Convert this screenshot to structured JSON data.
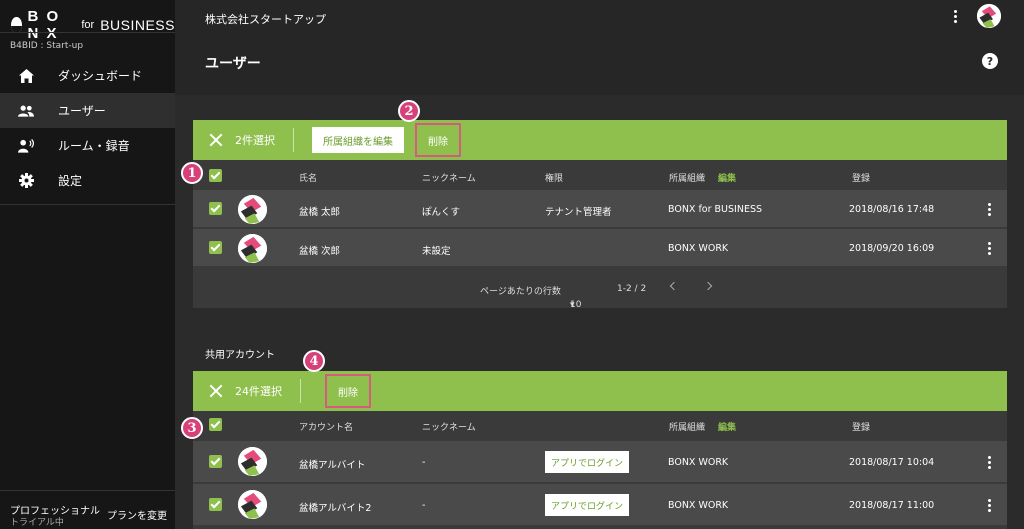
{
  "brand": {
    "name": "B O N X",
    "for": "for",
    "business": "BUSINESS"
  },
  "sidebar": {
    "org": "B4BID : Start-up",
    "items": [
      {
        "label": "ダッシュボード",
        "icon": "home-icon"
      },
      {
        "label": "ユーザー",
        "icon": "people-icon",
        "active": true
      },
      {
        "label": "ルーム・録音",
        "icon": "room-icon"
      },
      {
        "label": "設定",
        "icon": "gear-icon"
      }
    ],
    "plan": {
      "name": "プロフェッショナル",
      "sub": "トライアル中",
      "change": "プランを変更"
    }
  },
  "header": {
    "company": "株式会社スタートアップ",
    "title": "ユーザー",
    "help": "?"
  },
  "users_panel": {
    "selected": "2件選択",
    "edit_org": "所属組織を編集",
    "delete": "削除",
    "columns": {
      "name": "氏名",
      "nickname": "ニックネーム",
      "role": "権限",
      "org": "所属組織",
      "edit": "編集",
      "registered": "登録"
    },
    "rows": [
      {
        "name": "盆橋 太郎",
        "nickname": "ぽんくす",
        "role": "テナント管理者",
        "org": "BONX for BUSINESS",
        "registered": "2018/08/16 17:48"
      },
      {
        "name": "盆橋 次郎",
        "nickname": "未設定",
        "role": "",
        "org": "BONX WORK",
        "registered": "2018/09/20 16:09"
      }
    ],
    "pagination": {
      "rows_per_page_label": "ページあたりの行数",
      "rows_per_page": "10",
      "range": "1-2 / 2"
    }
  },
  "shared_panel": {
    "section_title": "共用アカウント",
    "selected": "24件選択",
    "delete": "削除",
    "columns": {
      "name": "アカウント名",
      "nickname": "ニックネーム",
      "org": "所属組織",
      "edit": "編集",
      "registered": "登録"
    },
    "rows": [
      {
        "name": "盆橋アルバイト",
        "nickname": "-",
        "login": "アプリでログイン",
        "org": "BONX WORK",
        "registered": "2018/08/17 10:04"
      },
      {
        "name": "盆橋アルバイト2",
        "nickname": "-",
        "login": "アプリでログイン",
        "org": "BONX WORK",
        "registered": "2018/08/17 11:00"
      }
    ]
  },
  "annotations": [
    "1",
    "2",
    "3",
    "4"
  ],
  "colors": {
    "accent": "#8fc04e",
    "highlight": "#d55b7f",
    "badge": "#d6417a"
  }
}
